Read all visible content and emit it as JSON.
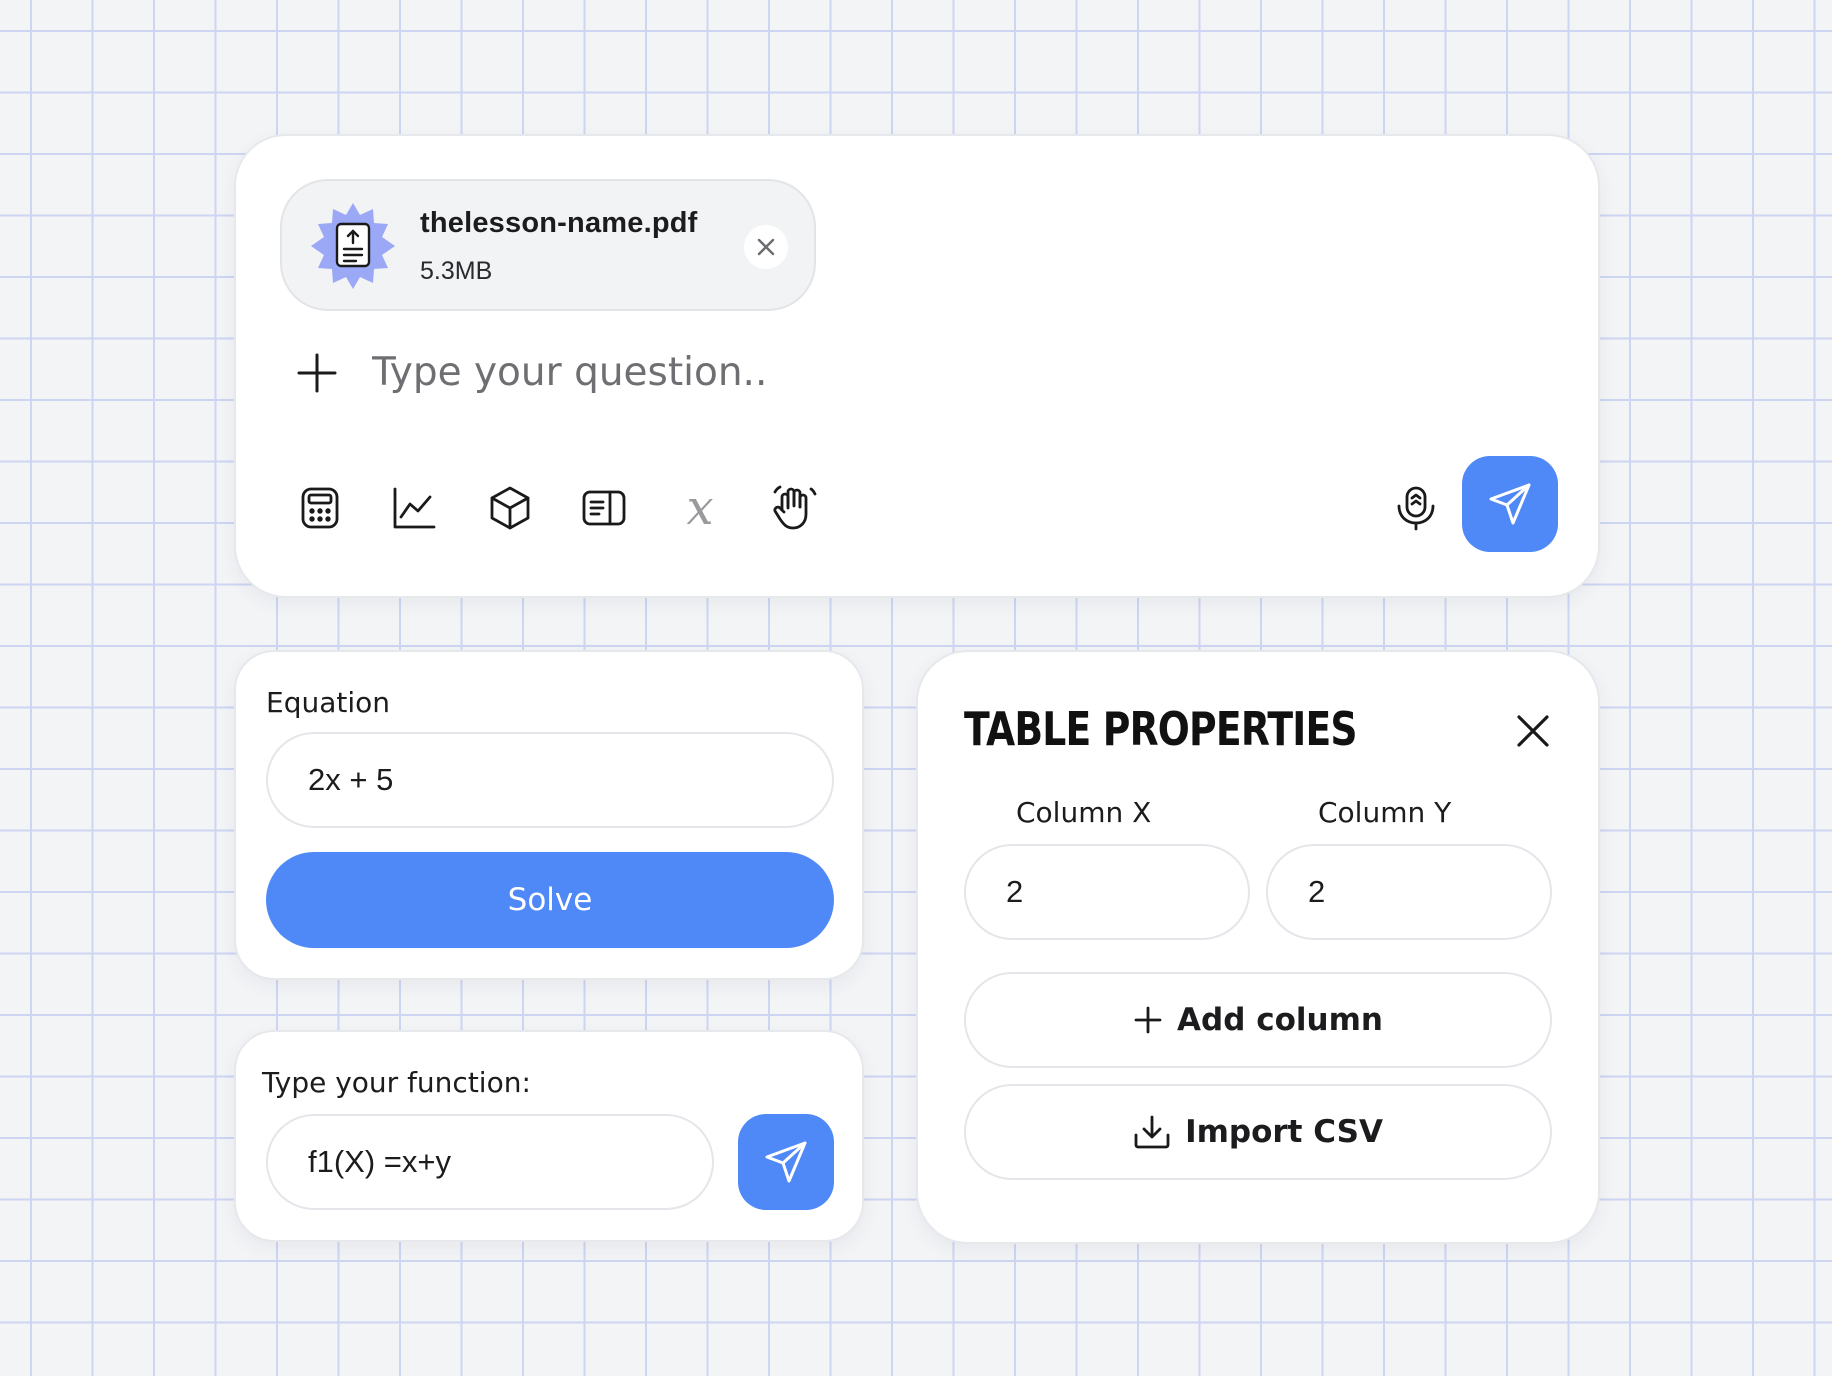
{
  "colors": {
    "accent": "#4f88f7",
    "badge": "#9aa8f5",
    "background": "#f3f4f6"
  },
  "composer": {
    "attachment": {
      "file_name": "thelesson-name.pdf",
      "file_size": "5.3MB",
      "icon": "pdf-file-icon",
      "remove_icon": "close-icon"
    },
    "add_icon": "plus-icon",
    "placeholder": "Type your question..",
    "tools": [
      "calculator-icon",
      "line-chart-icon",
      "cube-icon",
      "book-icon",
      "variable-x-icon",
      "hand-icon"
    ],
    "variable_glyph": "x",
    "mic_icon": "microphone-icon",
    "send_icon": "send-icon"
  },
  "equation": {
    "label": "Equation",
    "value": "2x + 5",
    "solve_label": "Solve"
  },
  "function": {
    "label": "Type your function:",
    "value": "f1(X) =x+y",
    "send_icon": "send-icon"
  },
  "table_properties": {
    "title": "TABLE PROPERTIES",
    "close_icon": "close-icon",
    "column_x_label": "Column X",
    "column_y_label": "Column Y",
    "column_x_value": "2",
    "column_y_value": "2",
    "add_column_label": "Add column",
    "import_csv_label": "Import CSV"
  }
}
